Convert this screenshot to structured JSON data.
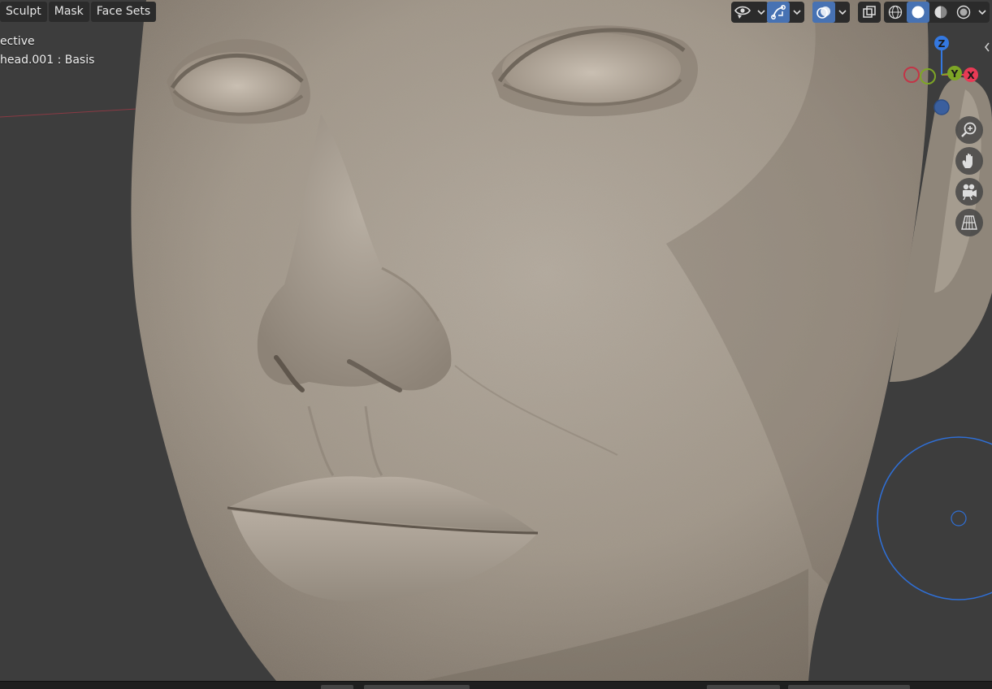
{
  "header_menu": {
    "sculpt": "Sculpt",
    "mask": "Mask",
    "face_sets": "Face Sets"
  },
  "viewport_overlay": {
    "view_name": "ective",
    "object_name": "head.001 : Basis"
  },
  "gizmo": {
    "z_label": "Z",
    "y_label": "Y",
    "x_label": "X",
    "colors": {
      "x": "#e83a55",
      "y": "#7ea626",
      "z": "#3478e0"
    }
  },
  "icons": {
    "visibility": "eye-icon",
    "gizmo_toggle": "gizmo-icon",
    "overlays": "overlay-icon",
    "xray": "xray-icon",
    "shading_wireframe": "wireframe-sphere-icon",
    "shading_solid": "solid-sphere-icon",
    "shading_material": "material-sphere-icon",
    "shading_rendered": "rendered-sphere-icon",
    "zoom": "zoom-icon",
    "pan": "hand-icon",
    "camera": "camera-icon",
    "ortho": "grid-icon"
  },
  "colors": {
    "viewport_bg": "#3d3d3d",
    "header_bg": "#2b2b2b",
    "accent": "#4772b3",
    "brush_circle": "#2f6fd6",
    "sculpt_clay": "#a49a8d"
  }
}
